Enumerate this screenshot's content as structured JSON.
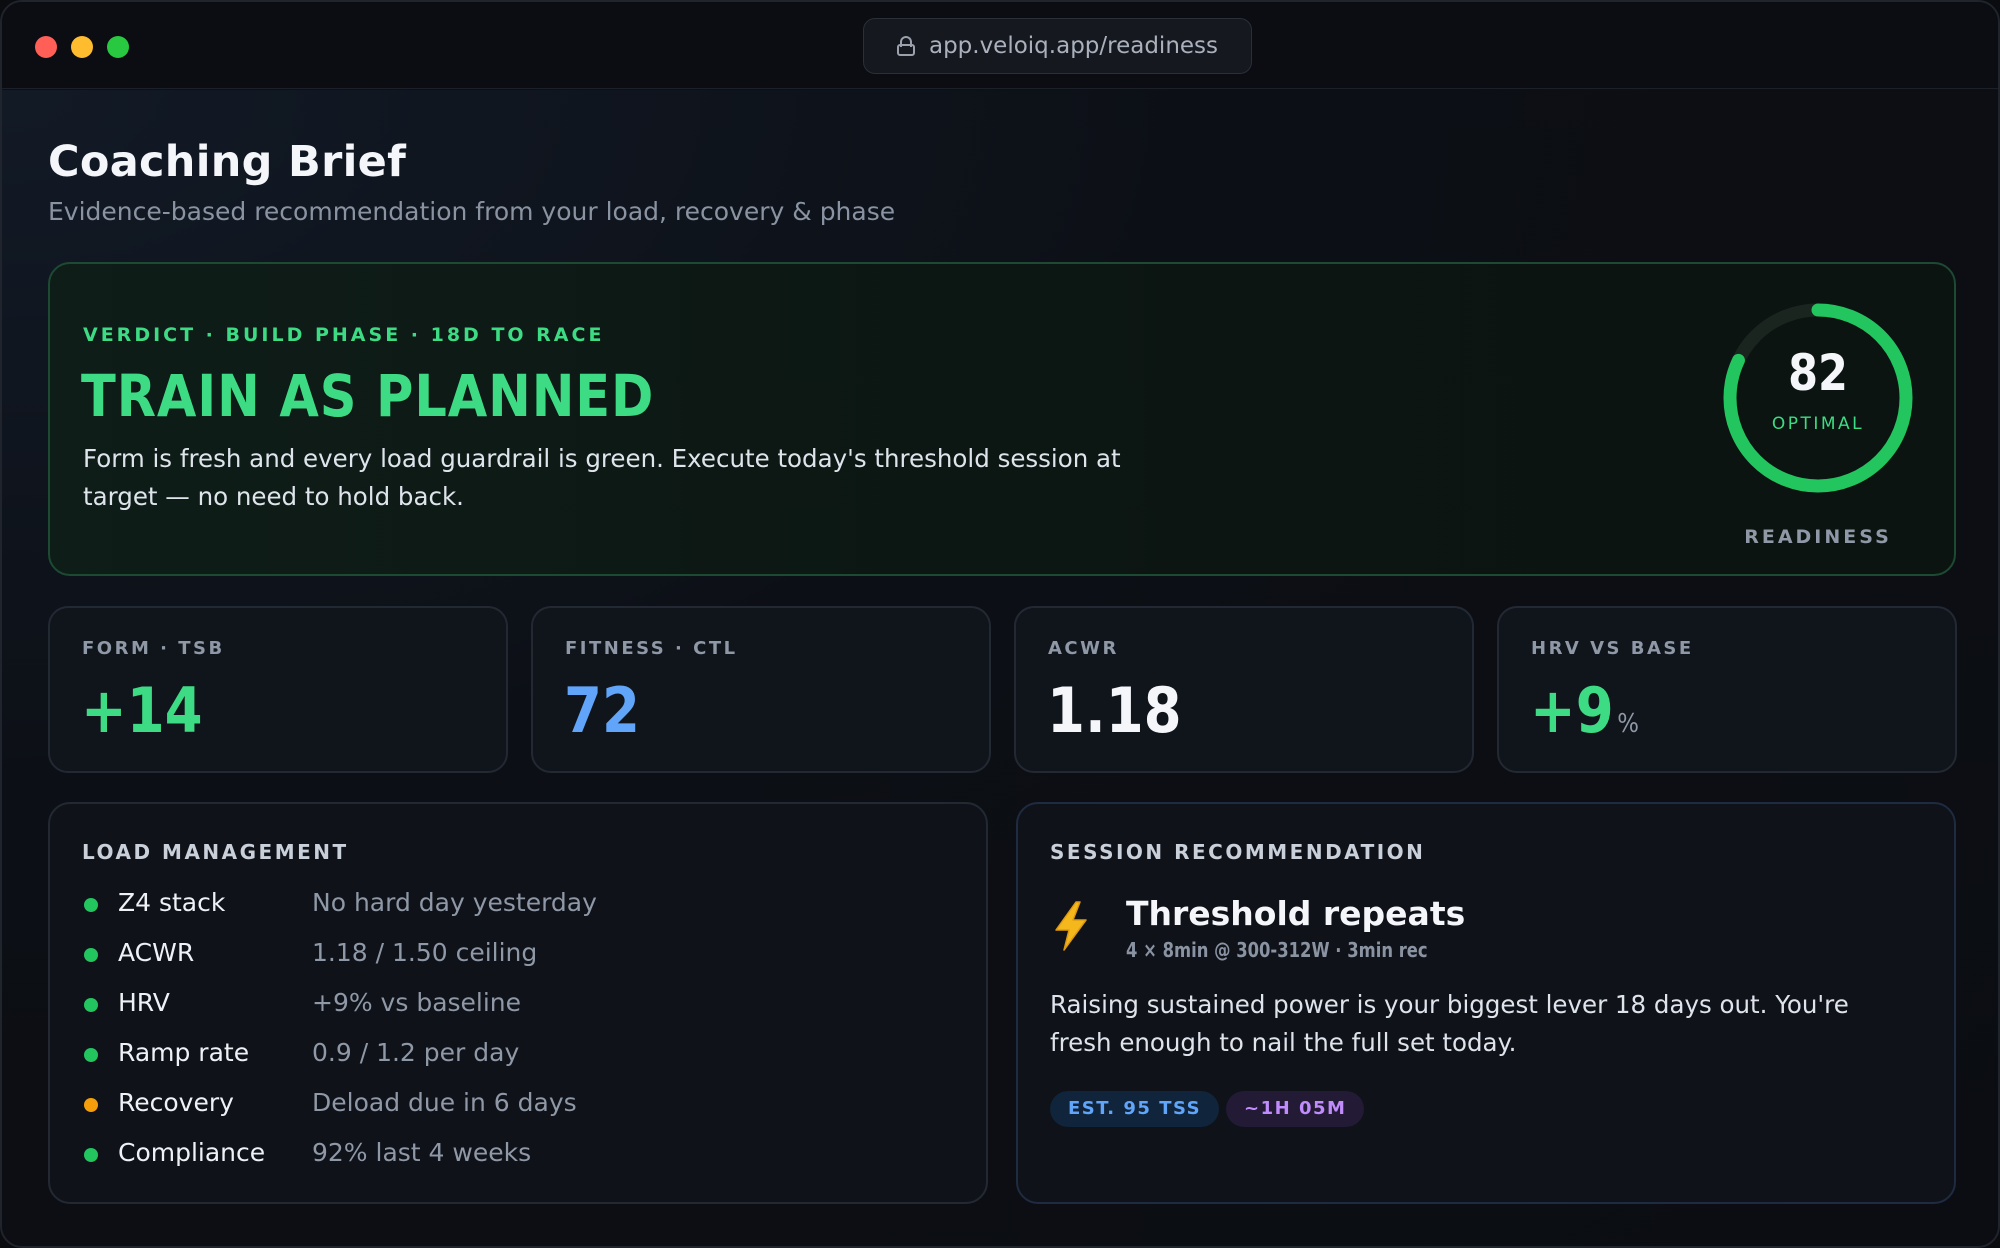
{
  "browser": {
    "url": "app.veloiq.app/readiness"
  },
  "header": {
    "title": "Coaching Brief",
    "subtitle": "Evidence-based recommendation from your load, recovery & phase"
  },
  "verdict": {
    "eyebrow": "VERDICT · BUILD PHASE · 18D TO RACE",
    "title": "TRAIN AS PLANNED",
    "body": "Form is fresh and every load guardrail is green. Execute today's threshold session at target — no need to hold back.",
    "readiness": {
      "score": "82",
      "status": "OPTIMAL",
      "label": "READINESS",
      "fraction": 0.82
    }
  },
  "metrics": [
    {
      "label": "FORM · TSB",
      "value": "+14",
      "unit": "",
      "color": "#3ddc84"
    },
    {
      "label": "FITNESS · CTL",
      "value": "72",
      "unit": "",
      "color": "#60a5fa"
    },
    {
      "label": "ACWR",
      "value": "1.18",
      "unit": "",
      "color": "#f4f6fa"
    },
    {
      "label": "HRV VS BASE",
      "value": "+9",
      "unit": "%",
      "color": "#3ddc84"
    }
  ],
  "load": {
    "title": "LOAD MANAGEMENT",
    "items": [
      {
        "name": "Z4 stack",
        "value": "No hard day yesterday",
        "status_color": "#22c55e"
      },
      {
        "name": "ACWR",
        "value": "1.18 / 1.50 ceiling",
        "status_color": "#22c55e"
      },
      {
        "name": "HRV",
        "value": "+9% vs baseline",
        "status_color": "#22c55e"
      },
      {
        "name": "Ramp rate",
        "value": "0.9 / 1.2 per day",
        "status_color": "#22c55e"
      },
      {
        "name": "Recovery",
        "value": "Deload due in 6 days",
        "status_color": "#f59e0b"
      },
      {
        "name": "Compliance",
        "value": "92% last 4 weeks",
        "status_color": "#22c55e"
      }
    ]
  },
  "session": {
    "title": "SESSION RECOMMENDATION",
    "icon": "lightning-bolt-icon",
    "name": "Threshold repeats",
    "detail": "4 × 8min @ 300-312W · 3min rec",
    "body": "Raising sustained power is your biggest lever 18 days out. You're fresh enough to nail the full set today.",
    "tags": {
      "tss": "EST. 95 TSS",
      "duration": "~1H 05M"
    }
  },
  "colors": {
    "accent_green": "#3ddc84",
    "accent_blue": "#60a5fa",
    "accent_purple": "#c08bfa",
    "warning": "#f59e0b"
  }
}
